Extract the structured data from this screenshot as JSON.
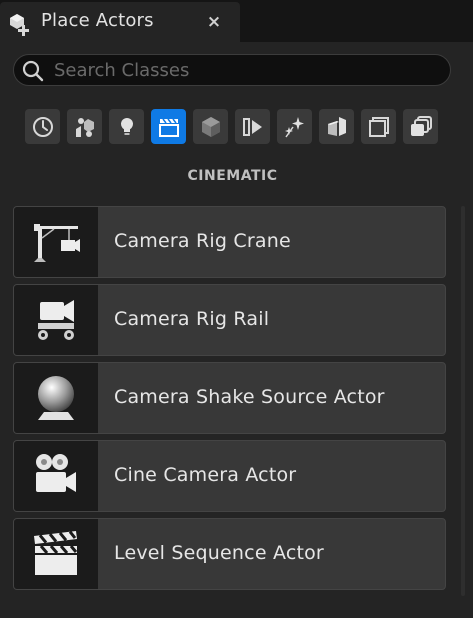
{
  "tab": {
    "title": "Place Actors",
    "close": "×"
  },
  "search": {
    "value": "",
    "placeholder": "Search Classes"
  },
  "categories": [
    {
      "icon": "clock-icon",
      "active": false
    },
    {
      "icon": "basic-shapes-icon",
      "active": false
    },
    {
      "icon": "lightbulb-icon",
      "active": false
    },
    {
      "icon": "cinematic-clapper-icon",
      "active": true
    },
    {
      "icon": "cube-icon",
      "active": false
    },
    {
      "icon": "play-volume-icon",
      "active": false
    },
    {
      "icon": "sparkles-icon",
      "active": false
    },
    {
      "icon": "geometry-blocks-icon",
      "active": false
    },
    {
      "icon": "stacked-squares-icon",
      "active": false
    },
    {
      "icon": "layers-icon",
      "active": false
    }
  ],
  "category_title": "CINEMATIC",
  "items": [
    {
      "label": "Camera Rig Crane",
      "icon": "camera-crane-icon"
    },
    {
      "label": "Camera Rig Rail",
      "icon": "camera-rail-icon"
    },
    {
      "label": "Camera Shake Source Actor",
      "icon": "sphere-source-icon"
    },
    {
      "label": "Cine Camera Actor",
      "icon": "film-camera-icon"
    },
    {
      "label": "Level Sequence Actor",
      "icon": "clapperboard-icon"
    }
  ],
  "colors": {
    "accent": "#0f7ae5",
    "panel": "#242424",
    "item": "#383838"
  }
}
